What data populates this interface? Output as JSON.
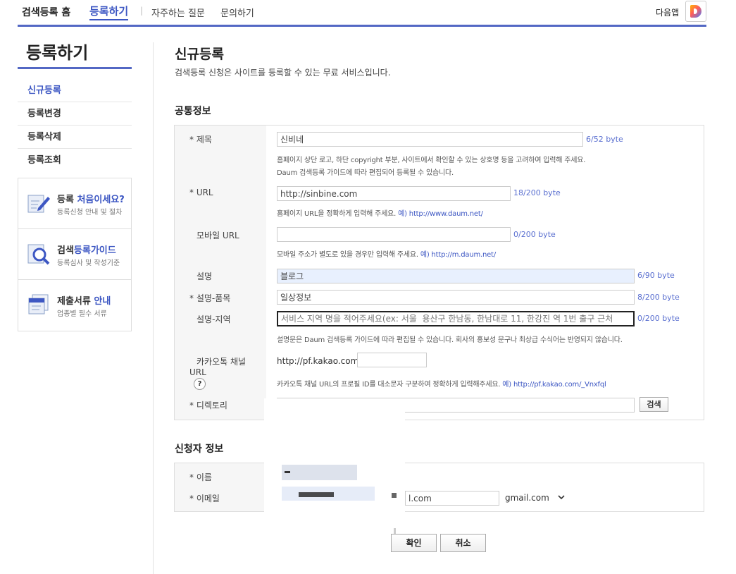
{
  "topnav": {
    "home": "검색등록 홈",
    "register": "등록하기",
    "separator": "|",
    "faq": "자주하는 질문",
    "contact": "문의하기",
    "daum_app": "다음앱"
  },
  "sidebar": {
    "title": "등록하기",
    "items": [
      {
        "label": "신규등록",
        "active": true
      },
      {
        "label": "등록변경"
      },
      {
        "label": "등록삭제"
      },
      {
        "label": "등록조회"
      }
    ],
    "boxes": [
      {
        "title_plain": "등록 ",
        "title_accent": "처음이세요?",
        "subtitle": "등록신청 안내 및 절차",
        "icon": "pencil-doc-icon"
      },
      {
        "title_plain": "검색",
        "title_accent": "등록가이드",
        "subtitle": "등록심사 및 작성기준",
        "icon": "magnifier-doc-icon"
      },
      {
        "title_plain": "제출서류 ",
        "title_accent": "안내",
        "subtitle": "업종별 필수 서류",
        "icon": "documents-icon"
      }
    ]
  },
  "main": {
    "title": "신규등록",
    "description": "검색등록 신청은 사이트를 등록할 수 있는 무료 서비스입니다."
  },
  "common": {
    "title": "공통정보",
    "fields": {
      "title": {
        "label": "* 제목",
        "value": "신비네",
        "count": "6/52 byte",
        "help1": "홈페이지 상단 로고, 하단 copyright 부분, 사이트에서 확인할 수 있는 상호명 등을 고려하여 입력해 주세요.",
        "help2": "Daum 검색등록 가이드에 따라 편집되어 등록될 수 있습니다."
      },
      "url": {
        "label": "* URL",
        "value": "http://sinbine.com",
        "count": "18/200 byte",
        "help": "홈페이지 URL을 정확하게 입력해 주세요.",
        "example": "예) http://www.daum.net/"
      },
      "mobile_url": {
        "label": "모바일 URL",
        "value": "",
        "count": "0/200 byte",
        "help": "모바일 주소가 별도로 있을 경우만 입력해 주세요.",
        "example": "예) http://m.daum.net/"
      },
      "desc": {
        "label": "설명",
        "value": "블로그",
        "count": "6/90 byte"
      },
      "desc_item": {
        "label": "* 설명-품목",
        "value": "일상정보",
        "count": "8/200 byte"
      },
      "desc_region": {
        "label": "설명-지역",
        "placeholder": "서비스 지역 명을 적어주세요(ex: 서울  용산구 한남동, 한남대로 11, 한강진 역 1번 출구 근처",
        "count": "0/200 byte",
        "help": "설명문은 Daum 검색등록 가이드에 따라 편집될 수 있습니다. 회사의 홍보성 문구나 최상급 수식어는 반영되지 않습니다."
      },
      "kakao": {
        "label1": "카카오톡 채널",
        "label2": "URL",
        "qmark": "?",
        "prefix": "http://pf.kakao.com/",
        "value": "",
        "help": "카카오톡 채널 URL의 프로필 ID를 대소문자 구분하여 정확하게 입력해주세요.",
        "example": "예) http://pf.kakao.com/_Vnxfql"
      },
      "directory": {
        "label": "* 디렉토리",
        "value": "",
        "button": "검색"
      }
    }
  },
  "applicant": {
    "title": "신청자 정보",
    "name_label": "* 이름",
    "email_label": "* 이메일",
    "email_local_suffix": "l.com",
    "email_domain": "gmail.com"
  },
  "actions": {
    "confirm": "확인",
    "cancel": "취소"
  },
  "colors": {
    "accent": "#3d57c3",
    "rule": "#5368c4"
  }
}
